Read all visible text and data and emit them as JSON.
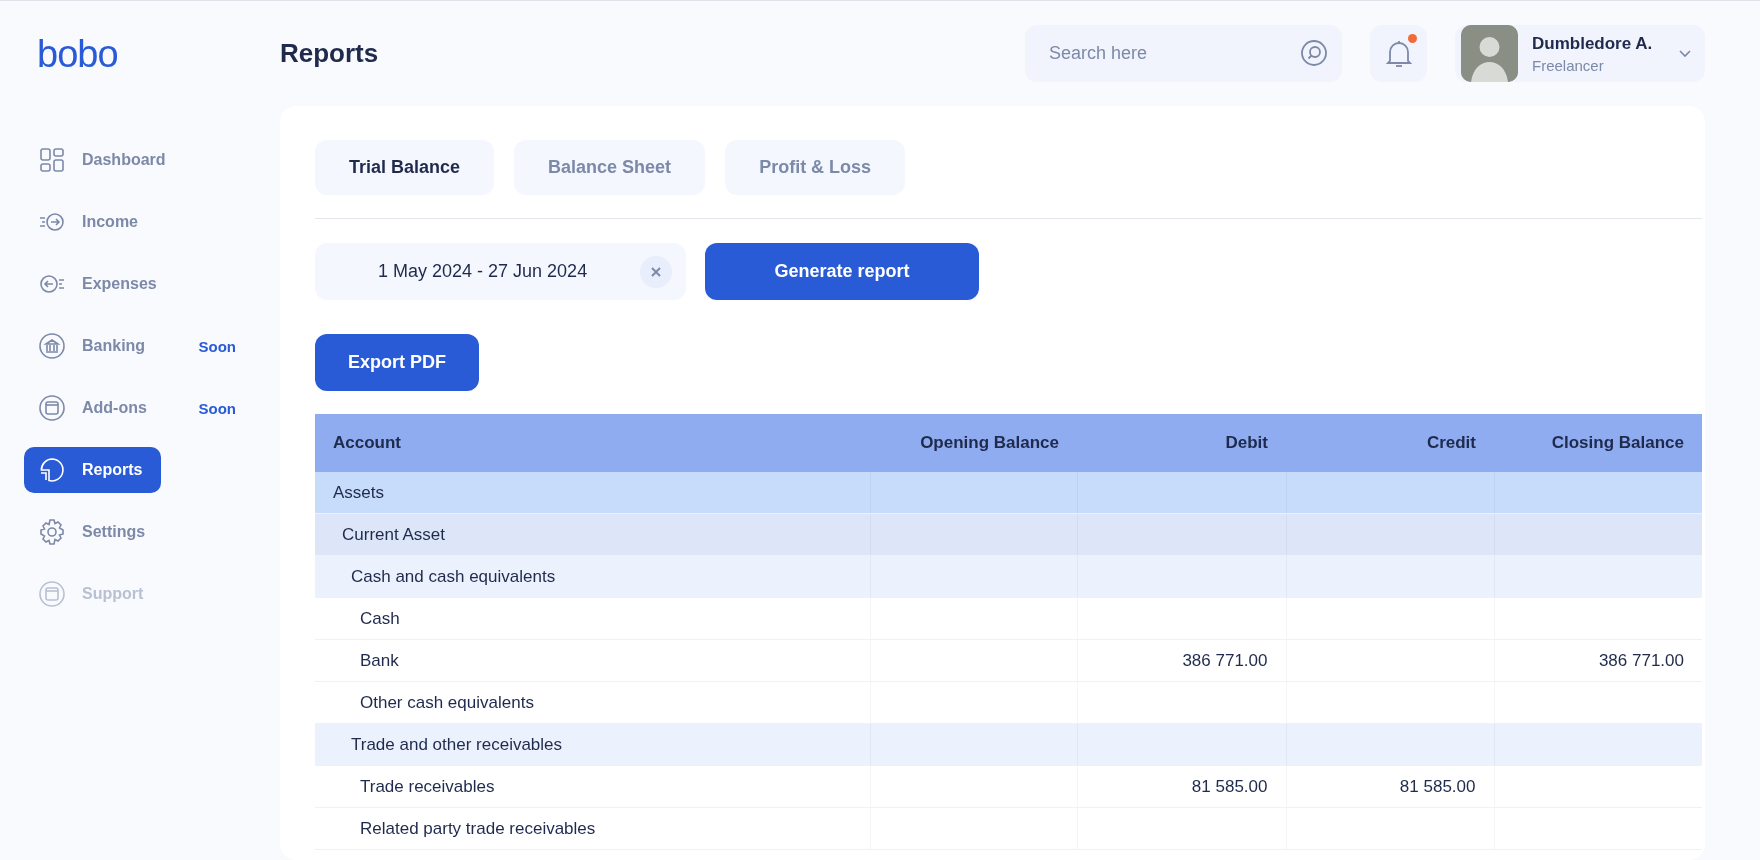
{
  "logo": "bobo",
  "sidebar": {
    "items": [
      {
        "label": "Dashboard",
        "selected": false,
        "disabled": false
      },
      {
        "label": "Income",
        "selected": false,
        "disabled": false
      },
      {
        "label": "Expenses",
        "selected": false,
        "disabled": false
      },
      {
        "label": "Banking",
        "selected": false,
        "disabled": false,
        "badge": "Soon"
      },
      {
        "label": "Add-ons",
        "selected": false,
        "disabled": false,
        "badge": "Soon"
      },
      {
        "label": "Reports",
        "selected": true,
        "disabled": false
      },
      {
        "label": "Settings",
        "selected": false,
        "disabled": false
      },
      {
        "label": "Support",
        "selected": false,
        "disabled": true
      }
    ]
  },
  "header": {
    "title": "Reports",
    "search": {
      "placeholder": "Search here"
    },
    "notifications": {
      "unread": true
    },
    "user": {
      "name": "Dumbledore A.",
      "role": "Freelancer"
    }
  },
  "tabs": [
    {
      "label": "Trial Balance",
      "selected": true
    },
    {
      "label": "Balance Sheet",
      "selected": false
    },
    {
      "label": "Profit & Loss",
      "selected": false
    }
  ],
  "date_range": {
    "value": "1 May 2024 - 27 Jun 2024"
  },
  "buttons": {
    "generate": "Generate report",
    "export": "Export PDF"
  },
  "table": {
    "columns": [
      "Account",
      "Opening Balance",
      "Debit",
      "Credit",
      "Closing Balance"
    ],
    "rows": [
      {
        "account": "Assets",
        "children": [
          {
            "account": "Current Asset",
            "children": [
              {
                "account": "Cash and cash equivalents",
                "children": [
                  {
                    "account": "Cash"
                  },
                  {
                    "account": "Bank",
                    "debit": "386 771.00",
                    "closing": "386 771.00"
                  },
                  {
                    "account": "Other cash equivalents"
                  }
                ]
              },
              {
                "account": "Trade and other receivables",
                "children": [
                  {
                    "account": "Trade receivables",
                    "debit": "81 585.00",
                    "credit": "81 585.00"
                  },
                  {
                    "account": "Related party trade receivables"
                  }
                ]
              }
            ]
          }
        ]
      }
    ]
  }
}
